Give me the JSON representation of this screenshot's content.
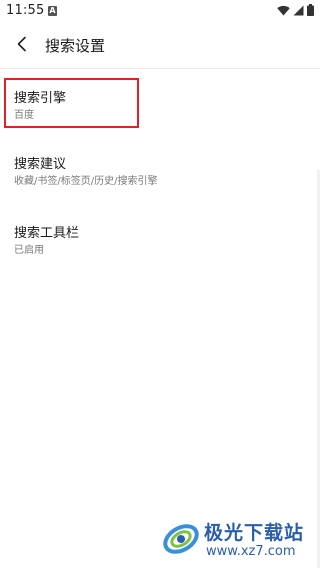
{
  "status_bar": {
    "time": "11:55",
    "notification_icon": "a-notification-icon",
    "wifi_icon": "wifi-icon",
    "signal_icon": "signal-icon",
    "battery_icon": "battery-icon"
  },
  "app_bar": {
    "back_icon": "back-arrow-icon",
    "title": "搜索设置"
  },
  "settings": {
    "items": [
      {
        "title": "搜索引擎",
        "subtitle": "百度",
        "highlighted": true
      },
      {
        "title": "搜索建议",
        "subtitle": "收藏/书签/标签页/历史/搜索引擎"
      },
      {
        "title": "搜索工具栏",
        "subtitle": "已启用"
      }
    ]
  },
  "watermark": {
    "name": "极光下载站",
    "url": "www.xz7.com"
  },
  "colors": {
    "highlight_border": "#e0212b",
    "watermark_blue": "#2b5ea8",
    "subtitle_gray": "#7a7a7a"
  }
}
